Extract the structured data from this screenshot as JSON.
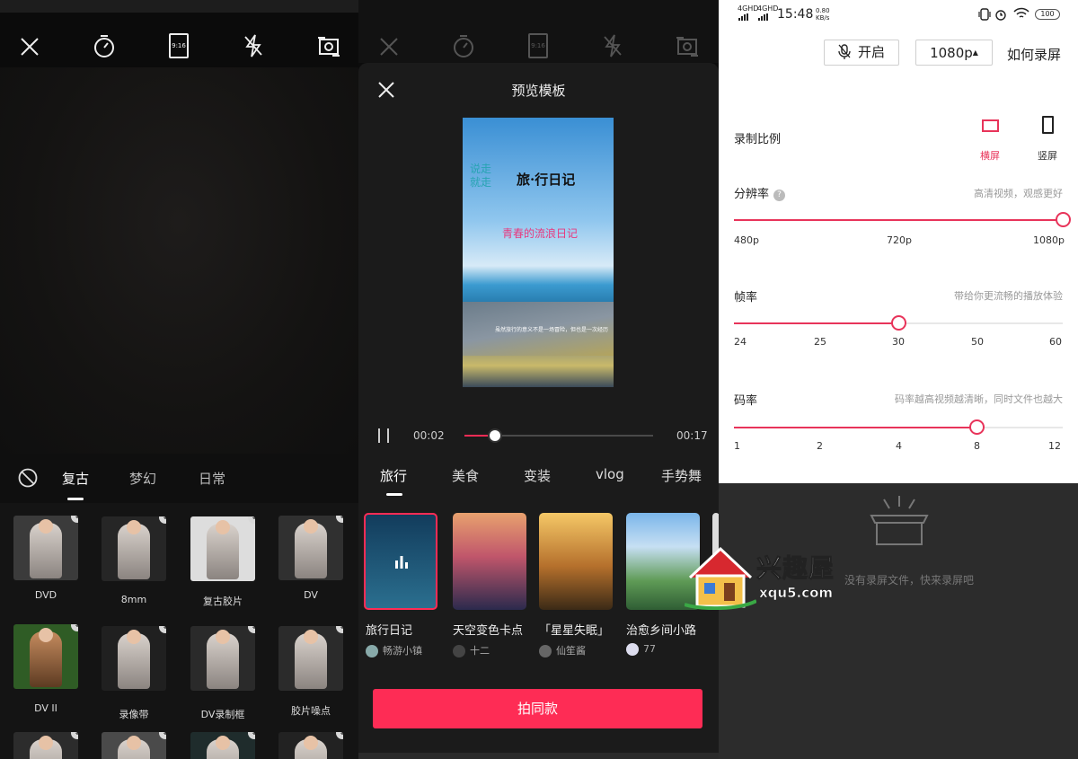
{
  "camera_screen": {
    "ratio_icon_label": "9:16",
    "filter_tabs": [
      "复古",
      "梦幻",
      "日常"
    ],
    "active_filter_tab": 0,
    "filters": [
      {
        "label": "DVD"
      },
      {
        "label": "8mm"
      },
      {
        "label": "复古胶片"
      },
      {
        "label": "DV"
      },
      {
        "label": "DV II"
      },
      {
        "label": "录像带"
      },
      {
        "label": "DV录制框"
      },
      {
        "label": "胶片噪点"
      },
      {
        "label": ""
      },
      {
        "label": ""
      },
      {
        "label": ""
      },
      {
        "label": ""
      }
    ]
  },
  "template_sheet": {
    "title": "预览模板",
    "preview": {
      "title_text": "旅·行日记",
      "side_text": "说走就走",
      "pink_text": "青春的流浪日记",
      "caption": "虽然旅行的意义不是一场冒险，但也是一次经历"
    },
    "time_current": "00:02",
    "time_total": "00:17",
    "progress": 0.16,
    "category_tabs": [
      "旅行",
      "美食",
      "变装",
      "vlog",
      "手势舞"
    ],
    "active_category": 0,
    "templates": [
      {
        "name": "旅行日记",
        "author": "畅游小镇",
        "colors": [
          "#123c5c",
          "#2b6f8f"
        ]
      },
      {
        "name": "天空变色卡点",
        "author": "十二",
        "colors": [
          "#e2826a",
          "#3f3a6a"
        ]
      },
      {
        "name": "「星星失眠」",
        "author": "仙笙酱",
        "colors": [
          "#f0b54a",
          "#5a3d1f"
        ]
      },
      {
        "name": "治愈乡间小路",
        "author": "77",
        "colors": [
          "#7bb6ea",
          "#4f8a4a"
        ]
      }
    ],
    "cta_label": "拍同款",
    "accent": "#fe2c55"
  },
  "record_settings": {
    "status_bar": {
      "signal_1": "4GHD",
      "signal_2": "4GHD",
      "time": "15:48",
      "speed_value": "0.80",
      "speed_unit": "KB/s",
      "battery": "100"
    },
    "mic_button": "开启",
    "resolution_button": "1080p",
    "how_to_label": "如何录屏",
    "ratio_label": "录制比例",
    "ratio_options": [
      {
        "label": "横屏",
        "selected": true
      },
      {
        "label": "竖屏",
        "selected": false
      }
    ],
    "resolution": {
      "label": "分辨率",
      "hint": "高清视频，观感更好",
      "ticks": [
        "480p",
        "720p",
        "1080p"
      ],
      "selected_index": 2
    },
    "frame_rate": {
      "label": "帧率",
      "hint": "带给你更流畅的播放体验",
      "ticks": [
        "24",
        "25",
        "30",
        "50",
        "60"
      ],
      "selected_index": 2
    },
    "bitrate": {
      "label": "码率",
      "hint": "码率越高视频越清晰，同时文件也越大",
      "ticks": [
        "1",
        "2",
        "4",
        "8",
        "12"
      ],
      "selected_index": 3
    },
    "empty_text": "没有录屏文件，快来录屏吧",
    "accent": "#e8345a"
  },
  "watermark": {
    "title": "兴趣屋",
    "url": "xqu5.com"
  }
}
